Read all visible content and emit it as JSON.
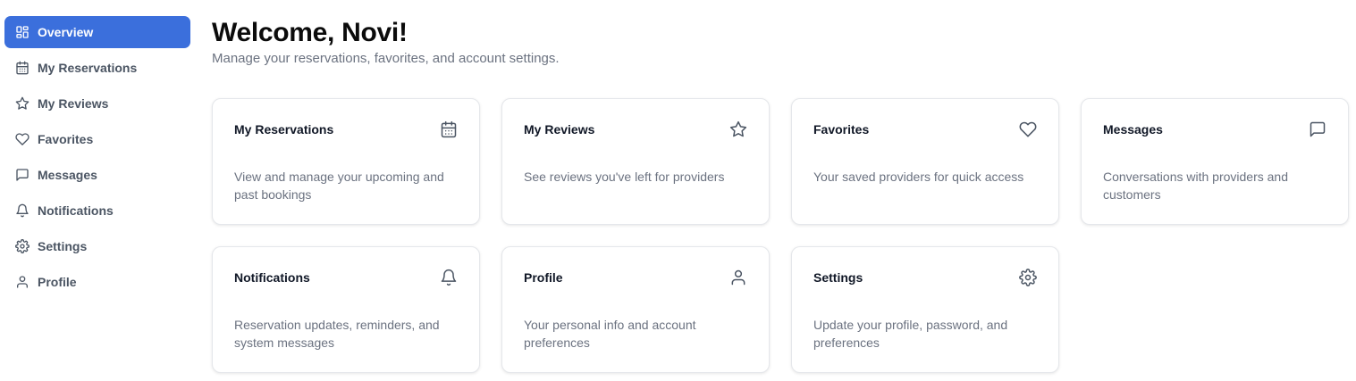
{
  "sidebar": {
    "items": [
      {
        "label": "Overview",
        "icon": "grid-icon",
        "active": true
      },
      {
        "label": "My Reservations",
        "icon": "calendar-icon"
      },
      {
        "label": "My Reviews",
        "icon": "star-icon"
      },
      {
        "label": "Favorites",
        "icon": "heart-icon"
      },
      {
        "label": "Messages",
        "icon": "message-icon"
      },
      {
        "label": "Notifications",
        "icon": "bell-icon"
      },
      {
        "label": "Settings",
        "icon": "gear-icon"
      },
      {
        "label": "Profile",
        "icon": "user-icon"
      }
    ]
  },
  "header": {
    "title": "Welcome, Novi!",
    "subtitle": "Manage your reservations, favorites, and account settings."
  },
  "cards": [
    {
      "title": "My Reservations",
      "icon": "calendar-icon",
      "description": "View and manage your upcoming and past bookings"
    },
    {
      "title": "My Reviews",
      "icon": "star-icon",
      "description": "See reviews you've left for providers"
    },
    {
      "title": "Favorites",
      "icon": "heart-icon",
      "description": "Your saved providers for quick access"
    },
    {
      "title": "Messages",
      "icon": "message-icon",
      "description": "Conversations with providers and customers"
    },
    {
      "title": "Notifications",
      "icon": "bell-icon",
      "description": "Reservation updates, reminders, and system messages"
    },
    {
      "title": "Profile",
      "icon": "user-icon",
      "description": "Your personal info and account preferences"
    },
    {
      "title": "Settings",
      "icon": "gear-icon",
      "description": "Update your profile, password, and preferences"
    }
  ],
  "colors": {
    "accent": "#3b6fdc",
    "text_muted": "#6b7280",
    "border": "#e5e7eb"
  }
}
